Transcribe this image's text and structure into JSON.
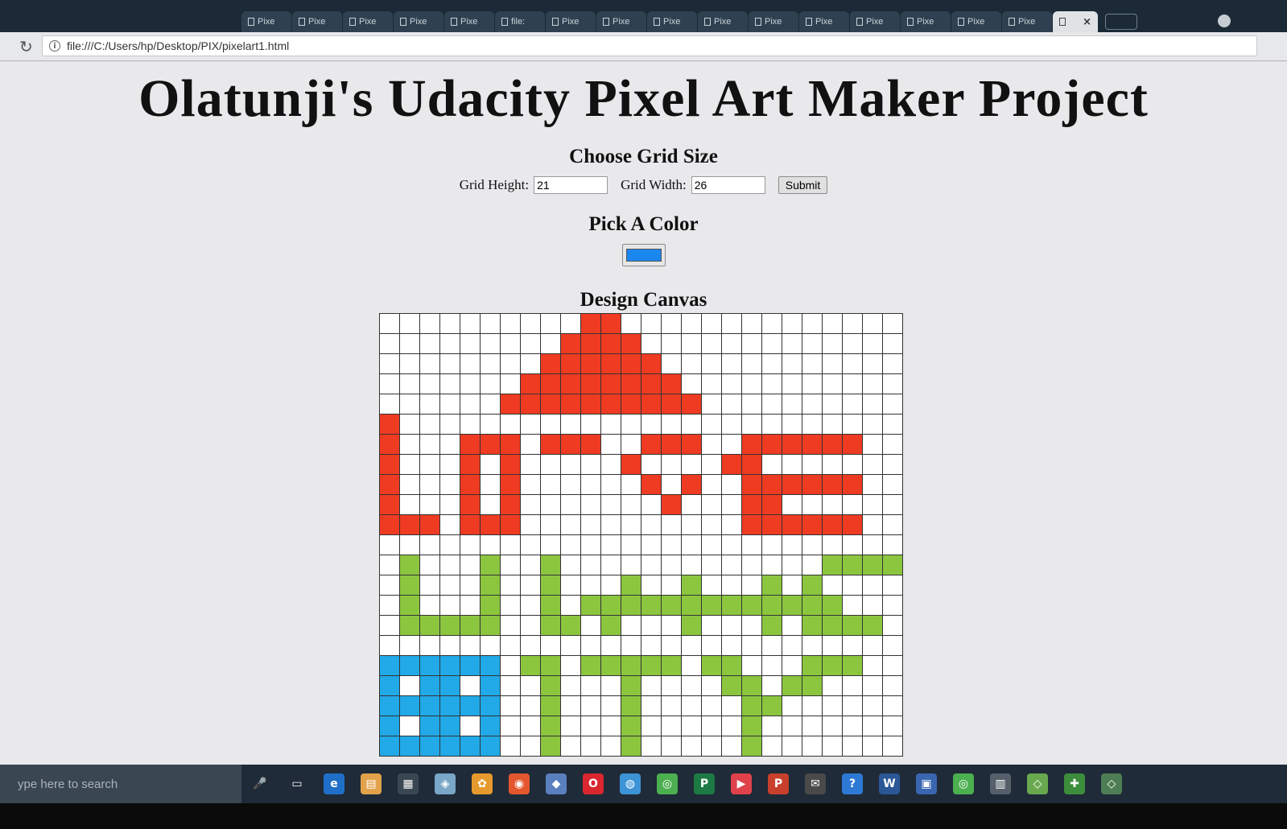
{
  "browser": {
    "tabs": [
      "Pixe",
      "Pixe",
      "Pixe",
      "Pixe",
      "Pixe",
      "file:",
      "Pixe",
      "Pixe",
      "Pixe",
      "Pixe",
      "Pixe",
      "Pixe",
      "Pixe",
      "Pixe",
      "Pixe",
      "Pixe"
    ],
    "active_tab_close": "×",
    "url": "file:///C:/Users/hp/Desktop/PIX/pixelart1.html"
  },
  "page": {
    "title": "Olatunji's Udacity Pixel Art Maker Project",
    "choose_heading": "Choose Grid Size",
    "height_label": "Grid Height:",
    "height_value": "21",
    "width_label": "Grid Width:",
    "width_value": "26",
    "submit_label": "Submit",
    "pick_heading": "Pick A Color",
    "picker_color": "#1a86f0",
    "canvas_heading": "Design Canvas"
  },
  "grid": {
    "rows": 21,
    "cols": 26,
    "visible_rows": 22,
    "colors": {
      "r": "#ee3b22",
      "g": "#8cc63f",
      "b": "#21a9e8",
      "w": "#ffffff"
    },
    "cells": [
      "..........rr..............",
      ".........rrrr.............",
      "........rrrrrr............",
      ".......rrrrrrrr...........",
      "......rrrrrrrrrr..........",
      "r.........................",
      "r...rrr.rrr..rrr..rrrrrr..",
      "r...r.r.....r....rr.......",
      "r...r.r......r.r..rrrrrr..",
      "r...r.r.......r...rr......",
      "rrr.rrr...........rrrrrr..",
      "..........................",
      ".g...g..g.............ggggg",
      ".g...g..g...g..g...g.g....",
      ".g...g..g.ggggggggggggg...",
      ".ggggg..gg.g...g...g.gggg.",
      "..........................",
      "bbbbbb.gg.ggggg.gg...ggg..",
      "bwbbwb..g...g....gg.gg....",
      "bbbbbb..g...g.....gg......",
      "bwbbwb..g...g.....g.......",
      "bbbbbb..g...g.....g......."
    ]
  },
  "taskbar": {
    "search_placeholder": "ype here to search",
    "icons": [
      "microphone-icon",
      "task-view-icon",
      "edge-icon",
      "file-explorer-icon",
      "store-icon",
      "app-icon",
      "settings-icon",
      "firefox-icon",
      "app-icon-2",
      "opera-icon",
      "app-icon-3",
      "chrome-icon",
      "publisher-icon",
      "video-icon",
      "powerpoint-icon",
      "mail-icon",
      "help-icon",
      "word-icon",
      "app-icon-4",
      "chrome-icon-2",
      "app-icon-5",
      "git-icon",
      "app-icon-6",
      "app-icon-7"
    ]
  }
}
